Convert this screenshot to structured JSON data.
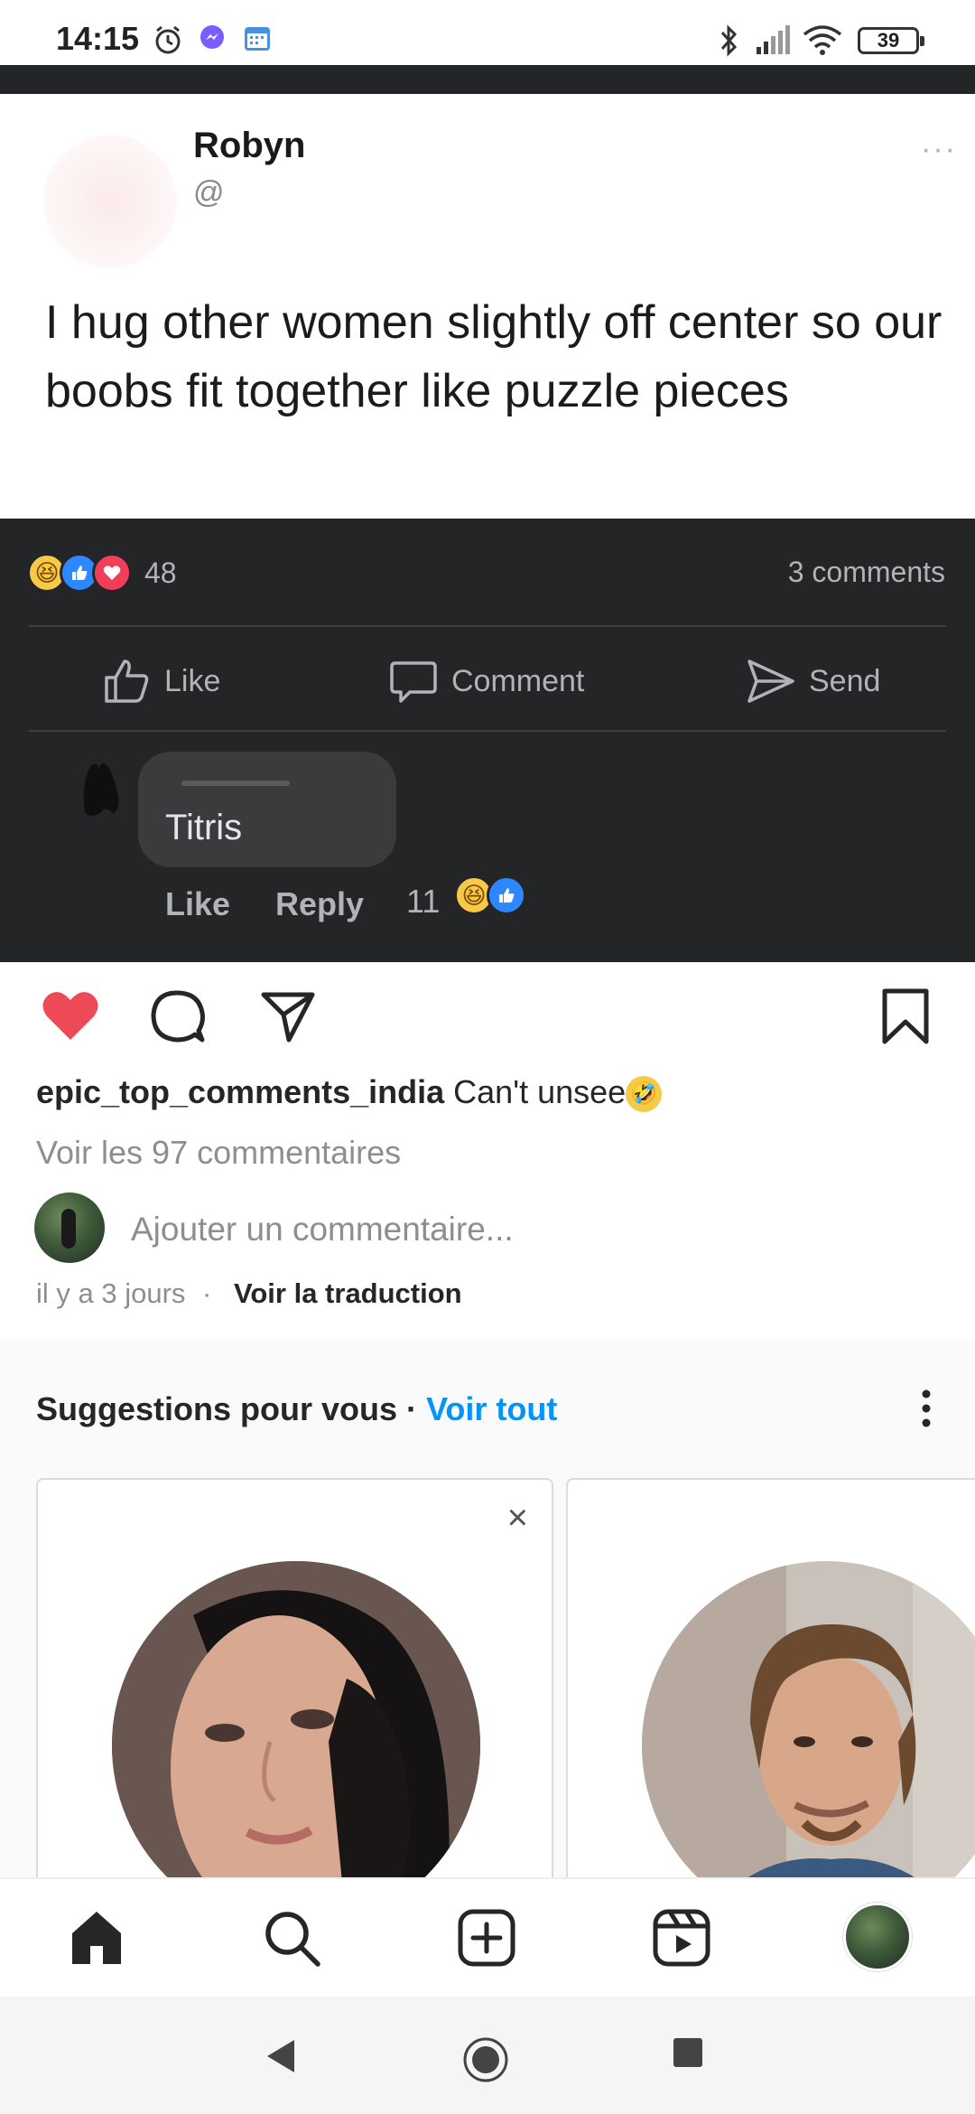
{
  "status_bar": {
    "time": "14:15",
    "battery": "39",
    "icons": [
      "alarm-icon",
      "messenger-icon",
      "calendar-icon",
      "bluetooth-icon",
      "signal-icon",
      "wifi-icon",
      "battery-icon"
    ]
  },
  "tweet": {
    "name": "Robyn",
    "handle": "@",
    "text": "I hug other women slightly off center so our boobs fit together like puzzle pieces"
  },
  "facebook": {
    "reaction_count": "48",
    "comments_count": "3 comments",
    "actions": [
      "Like",
      "Comment",
      "Send"
    ],
    "comment": {
      "text": "Titris",
      "like_label": "Like",
      "reply_label": "Reply",
      "reaction_count": "11"
    }
  },
  "post": {
    "username": "epic_top_comments_india",
    "caption": "Can't unsee",
    "view_comments": "Voir les 97 commentaires",
    "add_comment_placeholder": "Ajouter un commentaire...",
    "time_ago": "il y a 3 jours",
    "separator": "·",
    "see_translation": "Voir la traduction",
    "liked": true,
    "colors": {
      "like_red": "#ed4956",
      "link_blue": "#0095f6"
    }
  },
  "suggestions": {
    "title": "Suggestions pour vous",
    "separator": "·",
    "see_all": "Voir tout",
    "close_glyph": "×"
  },
  "bottom_nav": {
    "items": [
      "home-icon",
      "search-icon",
      "create-icon",
      "reels-icon",
      "profile-avatar"
    ]
  }
}
